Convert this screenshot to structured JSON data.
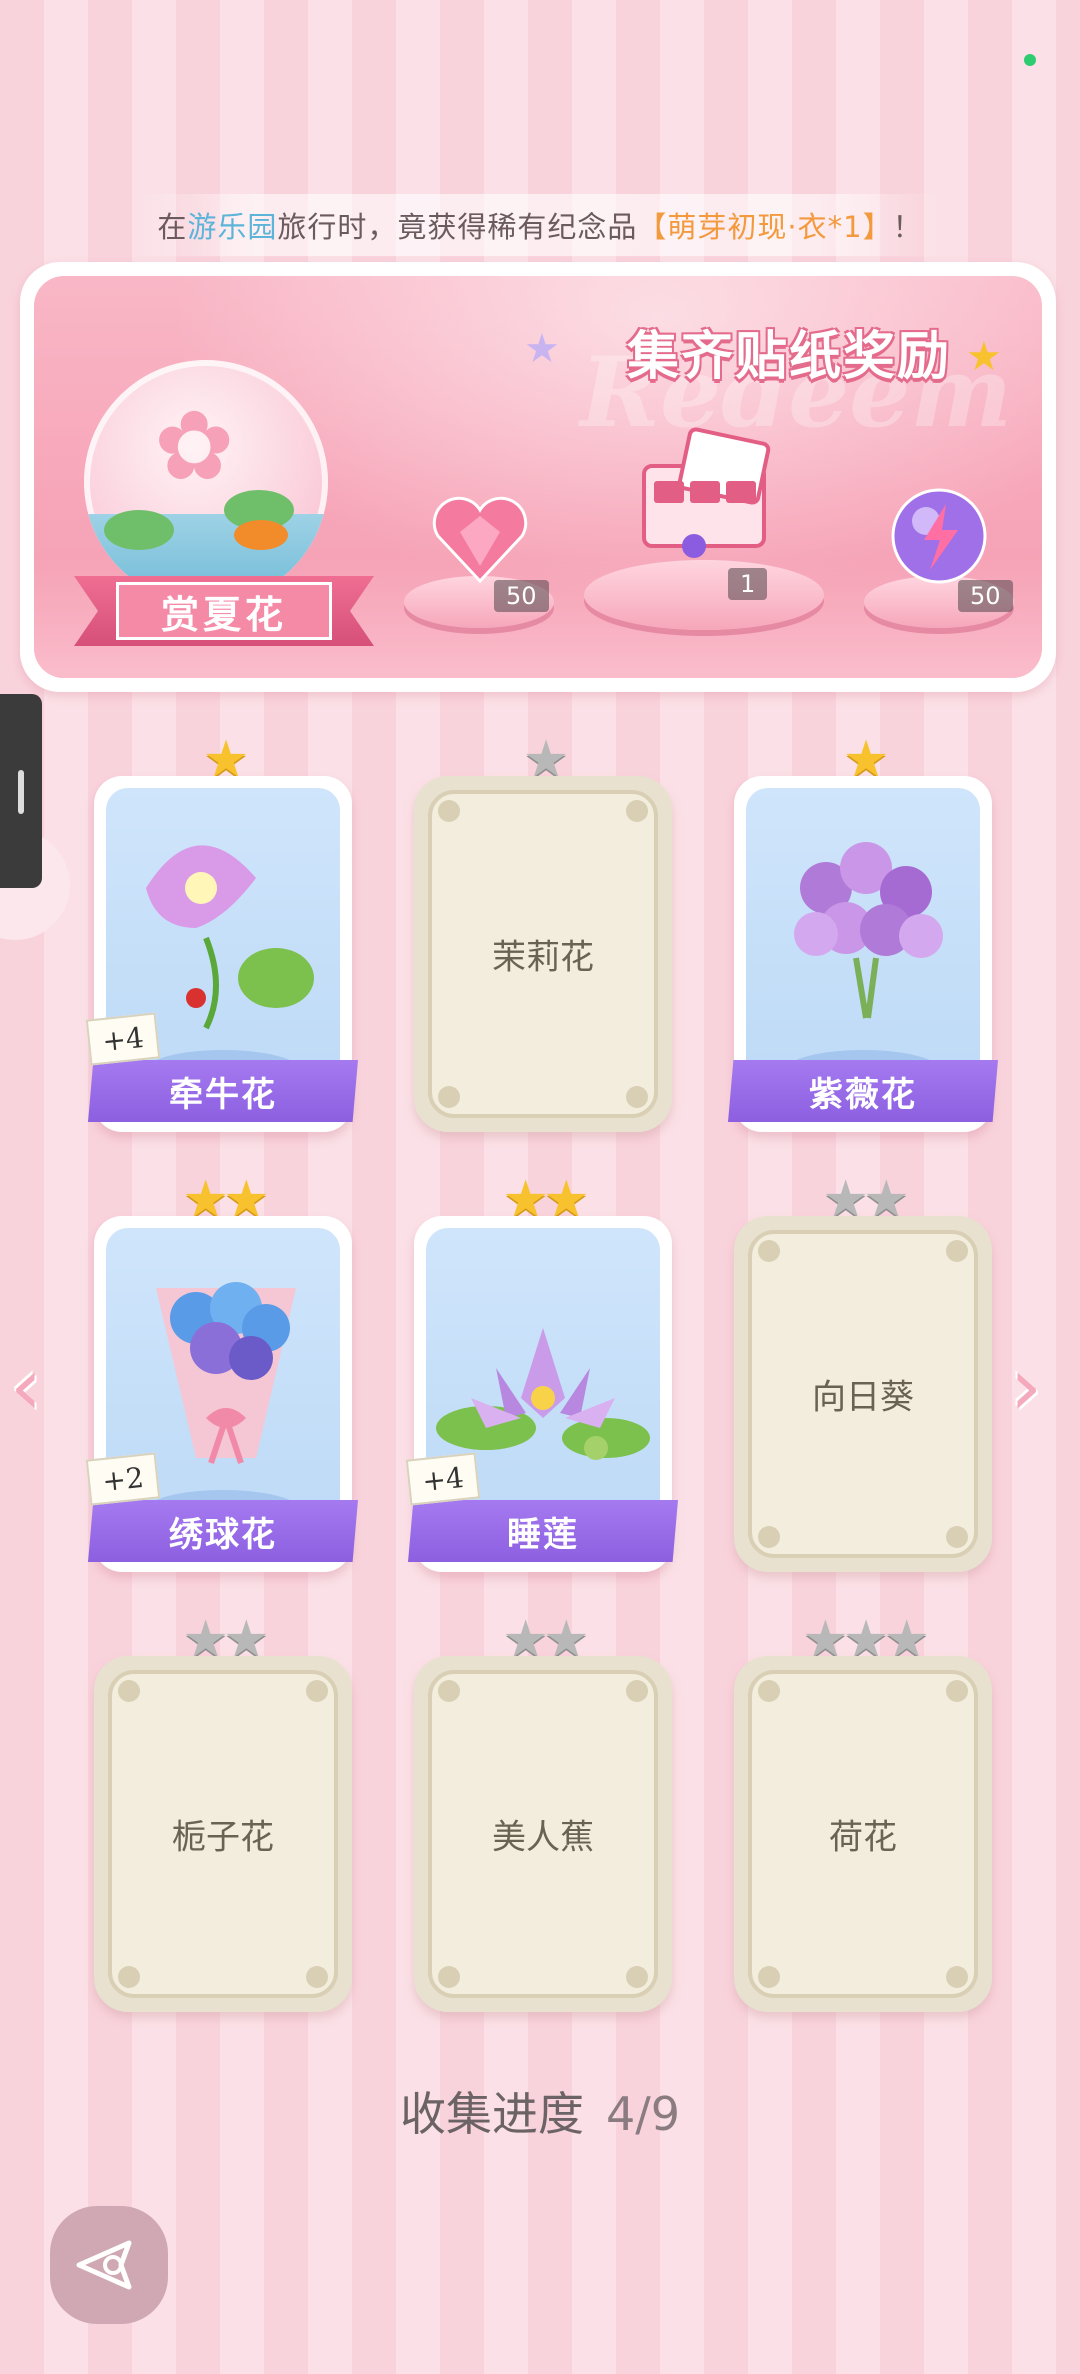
{
  "notification": {
    "prefix": "在",
    "place": "游乐园",
    "middle": "旅行时，竟获得稀有纪念品",
    "item": "【萌芽初现·衣*1】",
    "suffix": "！"
  },
  "reward_panel": {
    "title": "集齐贴纸奖励",
    "watermark": "Redeem",
    "album_name": "赏夏花",
    "rewards": [
      {
        "icon": "heart-gem-icon",
        "count": "50"
      },
      {
        "icon": "gift-box-icon",
        "count": "1"
      },
      {
        "icon": "energy-orb-icon",
        "count": "50"
      }
    ]
  },
  "cards": [
    {
      "name": "牵牛花",
      "collected": true,
      "stars": 1,
      "bonus": "+4",
      "art": "morning-glory"
    },
    {
      "name": "茉莉花",
      "collected": false,
      "stars": 1,
      "bonus": "",
      "art": ""
    },
    {
      "name": "紫薇花",
      "collected": true,
      "stars": 1,
      "bonus": "",
      "art": "crape-myrtle"
    },
    {
      "name": "绣球花",
      "collected": true,
      "stars": 2,
      "bonus": "+2",
      "art": "hydrangea"
    },
    {
      "name": "睡莲",
      "collected": true,
      "stars": 2,
      "bonus": "+4",
      "art": "water-lily"
    },
    {
      "name": "向日葵",
      "collected": false,
      "stars": 2,
      "bonus": "",
      "art": ""
    },
    {
      "name": "栀子花",
      "collected": false,
      "stars": 2,
      "bonus": "",
      "art": ""
    },
    {
      "name": "美人蕉",
      "collected": false,
      "stars": 2,
      "bonus": "",
      "art": ""
    },
    {
      "name": "荷花",
      "collected": false,
      "stars": 3,
      "bonus": "",
      "art": ""
    }
  ],
  "progress": {
    "label": "收集进度",
    "value": "4/9"
  },
  "colors": {
    "accent": "#8c5fe0",
    "star_gold": "#f8c22f",
    "star_gray": "#b8b8b8",
    "pink": "#f7a6b9"
  }
}
